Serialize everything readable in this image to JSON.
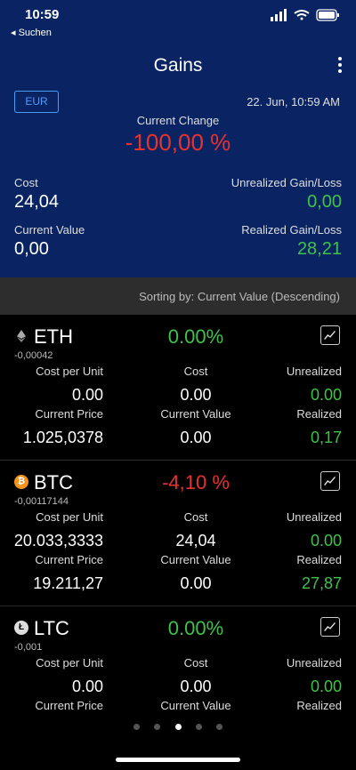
{
  "status": {
    "time": "10:59",
    "back": "◂ Suchen"
  },
  "nav": {
    "title": "Gains"
  },
  "summary": {
    "currency": "EUR",
    "date": "22. Jun, 10:59 AM",
    "change_label": "Current Change",
    "change_value": "-100,00 %",
    "cost_label": "Cost",
    "cost_value": "24,04",
    "unrealized_label": "Unrealized Gain/Loss",
    "unrealized_value": "0,00",
    "current_value_label": "Current Value",
    "current_value": "0,00",
    "realized_label": "Realized Gain/Loss",
    "realized_value": "28,21"
  },
  "sort": {
    "text": "Sorting by: Current Value (Descending)"
  },
  "labels": {
    "cost_per_unit": "Cost per Unit",
    "cost": "Cost",
    "unrealized": "Unrealized",
    "current_price": "Current Price",
    "current_value": "Current Value",
    "realized": "Realized"
  },
  "coins": [
    {
      "symbol": "ETH",
      "qty": "-0,00042",
      "pct": "0.00%",
      "cost_per_unit": "0.00",
      "cost": "0.00",
      "unrealized": "0.00",
      "current_price": "1.025,0378",
      "current_value": "0.00",
      "realized": "0,17"
    },
    {
      "symbol": "BTC",
      "qty": "-0,00117144",
      "pct": "-4,10 %",
      "cost_per_unit": "20.033,3333",
      "cost": "24,04",
      "unrealized": "0.00",
      "current_price": "19.211,27",
      "current_value": "0.00",
      "realized": "27,87"
    },
    {
      "symbol": "LTC",
      "qty": "-0,001",
      "pct": "0.00%",
      "cost_per_unit": "0.00",
      "cost": "0.00",
      "unrealized": "0.00",
      "current_price": "",
      "current_value": "",
      "realized": ""
    }
  ],
  "icons": {
    "eth": "ethereum-icon",
    "btc": "bitcoin-icon",
    "ltc": "litecoin-icon",
    "chart": "chart-icon",
    "more": "more-vertical-icon"
  },
  "colors": {
    "header_bg": "#0a2463",
    "accent": "#4a9cff",
    "positive": "#3fc24a",
    "negative": "#e8322f"
  }
}
